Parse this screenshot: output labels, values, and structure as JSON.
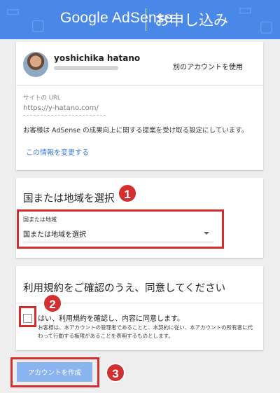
{
  "header": {
    "logo_text": "Google AdSense",
    "title": "お申し込み",
    "brand_color": "#4a88e8"
  },
  "account": {
    "name": "yoshichika hatano",
    "switch_label": "別のアカウントを使用"
  },
  "site": {
    "label": "サイトの URL",
    "url": "https://y-hatano.com/"
  },
  "notice": "お客様は AdSense の成果向上に関する提案を受け取る設定にしています。",
  "change_link": "この情報を変更する",
  "region": {
    "section_title": "国または地域を選択",
    "field_label": "国または地域",
    "selected_value": "国または地域を選択"
  },
  "terms": {
    "section_title": "利用規約をご確認のうえ、同意してください",
    "agree_label": "はい、利用規約を確認し、内容に同意します。",
    "agree_sub": "お客様は、本アカウントの管理者であることと、本契約に従い、本アカウントの所有者に代わって行動する権限があることを表明するものとします。",
    "checked": false
  },
  "create_button": "アカウントを作成",
  "annotations": {
    "badge1": "1",
    "badge2": "2",
    "badge3": "3",
    "color": "#d32f2f"
  }
}
